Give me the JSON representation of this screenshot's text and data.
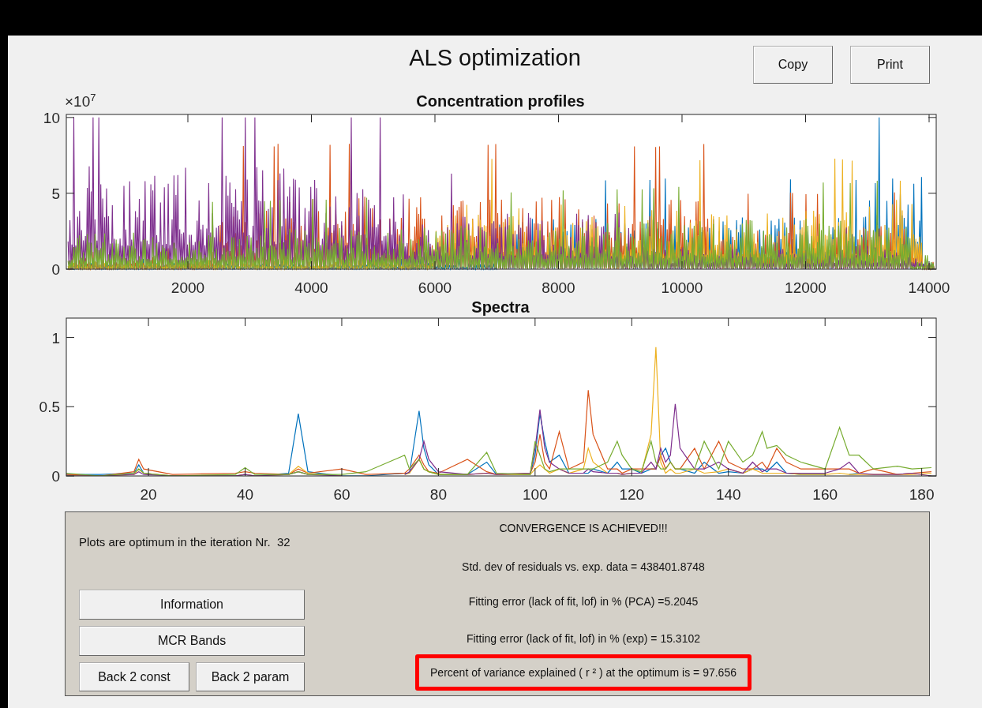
{
  "window": {
    "title": "ALS optimization"
  },
  "toolbar": {
    "buttons": [
      "Copy",
      "Print"
    ]
  },
  "concentration_profiles": {
    "title": "Concentration profiles",
    "exponent": "×10$^{7}$",
    "x_tick_labels": [
      "2000",
      "4000",
      "6000",
      "8000",
      "10000",
      "12000",
      "14000"
    ],
    "y_tick_labels": [
      "10",
      "5",
      "0"
    ]
  },
  "spectra": {
    "chart_data": {
      "type": "line",
      "title": "Spectra",
      "xlim": [
        3,
        183
      ],
      "ylim": [
        0,
        1.14
      ],
      "xticks": [
        20,
        40,
        60,
        80,
        100,
        120,
        140,
        160,
        180
      ],
      "yticks": [
        0,
        0.5,
        1
      ],
      "x": [
        3,
        10,
        17,
        18,
        19,
        25,
        38,
        40,
        42,
        49,
        51,
        53,
        60,
        65,
        73,
        74,
        76,
        77,
        78,
        80,
        86,
        90,
        92,
        99,
        100,
        101,
        102,
        103,
        105,
        107,
        110,
        111,
        112,
        115,
        117,
        118,
        120,
        122,
        124,
        125,
        126,
        127,
        128,
        129,
        130,
        133,
        135,
        138,
        140,
        143,
        145,
        147,
        148,
        150,
        152,
        155,
        160,
        163,
        165,
        167,
        170,
        175,
        178,
        182
      ],
      "series": [
        {
          "color": "#0072bd",
          "values": [
            0.01,
            0.01,
            0.02,
            0.08,
            0.02,
            0,
            0,
            0.01,
            0,
            0.02,
            0.45,
            0.03,
            0,
            0,
            0.02,
            0.02,
            0.47,
            0.2,
            0.08,
            0.01,
            0.01,
            0.1,
            0.01,
            0.01,
            0.15,
            0.45,
            0.25,
            0.1,
            0.15,
            0.02,
            0.02,
            0.02,
            0.05,
            0.02,
            0.1,
            0.05,
            0.05,
            0.02,
            0.05,
            0.05,
            0.15,
            0.2,
            0.1,
            null,
            0.05,
            0.02,
            0.1,
            0.02,
            0.03,
            0.02,
            0.05,
            0.05,
            0.03,
            0.1,
            0.02,
            0.01,
            0.01,
            null,
            0.01,
            0.02,
            null,
            null,
            null,
            null
          ]
        },
        {
          "color": "#d95319",
          "values": [
            0.01,
            0,
            0.03,
            0.12,
            0.05,
            0.01,
            0.02,
            0.03,
            0.02,
            0.01,
            0.05,
            0.02,
            0.05,
            0.01,
            0.02,
            0.05,
            0.15,
            0.08,
            0.03,
            0.02,
            0.12,
            0.03,
            0.01,
            0.02,
            0.1,
            0.3,
            0.1,
            0.05,
            0.32,
            0.05,
            0.1,
            0.62,
            0.3,
            0.05,
            0.05,
            0.02,
            0.05,
            0.05,
            0.05,
            0.05,
            0.15,
            0.05,
            0.1,
            0.05,
            0.05,
            0.2,
            0.05,
            0.25,
            0.1,
            0.05,
            0.05,
            0.1,
            0.05,
            0.2,
            0.1,
            0.05,
            0.05,
            0.05,
            0.05,
            0.02,
            0.05,
            0.01,
            0.02,
            0.03
          ]
        },
        {
          "color": "#edb120",
          "values": [
            0,
            0,
            0.01,
            0.05,
            0.02,
            0,
            0,
            0.01,
            0,
            0.01,
            0.07,
            0.02,
            0,
            null,
            0.01,
            0.02,
            0.12,
            0.05,
            0.03,
            0.01,
            0.01,
            0.02,
            0.01,
            0.01,
            0.05,
            0.08,
            0.05,
            0.02,
            0.05,
            0.02,
            0.05,
            0.2,
            0.1,
            0.02,
            0.02,
            0.01,
            0.02,
            0.02,
            0.3,
            0.93,
            0.1,
            0.02,
            0.05,
            0.02,
            0.02,
            0.05,
            0.02,
            0.03,
            0.05,
            0.02,
            0.05,
            0.02,
            0.02,
            0.02,
            0.02,
            0.01,
            0.01,
            0.02,
            0.01,
            0.01,
            0.01,
            0.01,
            0.01,
            0.02
          ]
        },
        {
          "color": "#7e2f8e",
          "values": [
            0,
            0,
            0.01,
            0.03,
            0.01,
            0,
            0,
            0.01,
            0,
            0.01,
            0.03,
            0.01,
            0,
            null,
            0.01,
            0.03,
            0.12,
            0.25,
            0.12,
            0.03,
            0.01,
            0.02,
            0.01,
            0.02,
            0.2,
            0.48,
            0.2,
            0.1,
            0.05,
            0.02,
            0.02,
            0.05,
            0.03,
            0.02,
            0.02,
            0.01,
            0.02,
            0.02,
            0.1,
            0.05,
            0.2,
            0.1,
            0.15,
            0.52,
            0.2,
            0.05,
            0.05,
            0.1,
            0.05,
            0.02,
            0.1,
            0.03,
            0.05,
            0.05,
            0.02,
            0.02,
            0.02,
            0.05,
            0.1,
            0.02,
            0.01,
            0.01,
            0.02,
            0
          ]
        },
        {
          "color": "#77ac30",
          "values": [
            0.02,
            0,
            0.02,
            0.05,
            0.02,
            0,
            0.01,
            0.06,
            0.01,
            0.01,
            0.03,
            0.01,
            0.01,
            0.03,
            0.15,
            0.05,
            0.12,
            0.05,
            0.03,
            0.01,
            0.01,
            0.17,
            0.02,
            0.01,
            0.25,
            0.15,
            0.05,
            0.03,
            0.05,
            0.05,
            0.05,
            0.05,
            0.05,
            0.1,
            0.25,
            0.15,
            0.05,
            0.03,
            0.25,
            0.1,
            0.05,
            0.05,
            0.1,
            0.05,
            0.05,
            0.05,
            0.25,
            0.05,
            0.25,
            0.1,
            0.15,
            0.32,
            0.2,
            0.22,
            0.15,
            0.1,
            0.05,
            0.35,
            0.15,
            0.15,
            0.05,
            0.07,
            0.05,
            0.06
          ]
        }
      ]
    }
  },
  "results_panel": {
    "iteration_text": "Plots are optimum in the iteration Nr.  32",
    "buttons": [
      {
        "label": "Information",
        "kind": "wide"
      },
      {
        "label": "MCR Bands",
        "kind": "wide"
      },
      {
        "label": "Back 2 const",
        "kind": "half"
      },
      {
        "label": "Back 2 param",
        "kind": "half"
      }
    ],
    "status_lines": [
      {
        "text": "CONVERGENCE IS ACHIEVED!!!",
        "highlighted": false
      },
      {
        "text": "Std. dev of residuals vs. exp. data = 438401.8748",
        "highlighted": false
      },
      {
        "text": "Fitting error (lack of fit, lof) in % (PCA) =5.2045",
        "highlighted": false
      },
      {
        "text": "Fitting error (lack of fit, lof) in % (exp) = 15.3102",
        "highlighted": false
      },
      {
        "text": "Percent of variance explained ( r ² ) at the optimum is = 97.656",
        "highlighted": true
      }
    ]
  }
}
